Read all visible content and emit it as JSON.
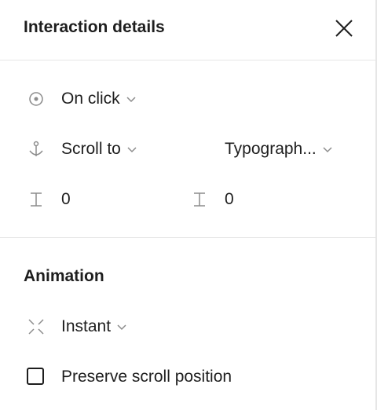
{
  "header": {
    "title": "Interaction details",
    "close_icon": "close-icon"
  },
  "trigger": {
    "event": "On click",
    "action": "Scroll to",
    "destination": "Typograph...",
    "offset_x": "0",
    "offset_y": "0"
  },
  "animation": {
    "title": "Animation",
    "type": "Instant",
    "preserve_scroll_label": "Preserve scroll position",
    "preserve_scroll_checked": false
  },
  "colors": {
    "text": "#1e1e1e",
    "icon": "#8c8c8c",
    "divider": "#e6e6e6"
  }
}
